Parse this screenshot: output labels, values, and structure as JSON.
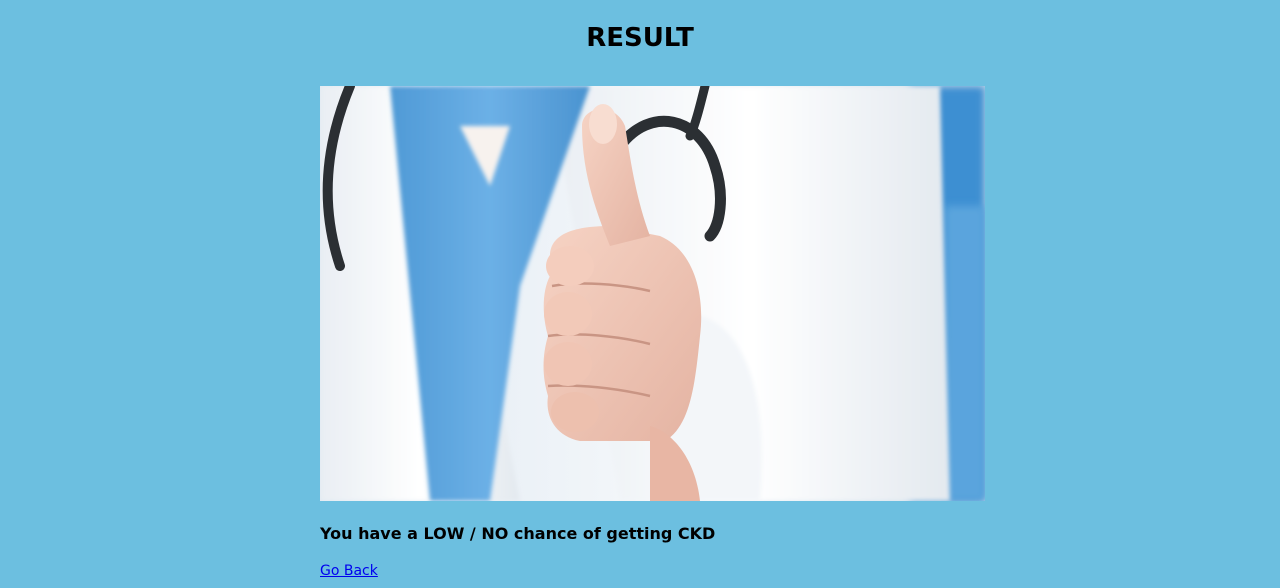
{
  "page": {
    "title": "RESULT",
    "result_message": "You have a LOW / NO chance of getting CKD",
    "back_link_label": "Go Back"
  },
  "image": {
    "subject": "doctor-thumbs-up-photo"
  },
  "colors": {
    "background": "#6cbfe0",
    "link": "#0000ee",
    "text": "#000000"
  }
}
